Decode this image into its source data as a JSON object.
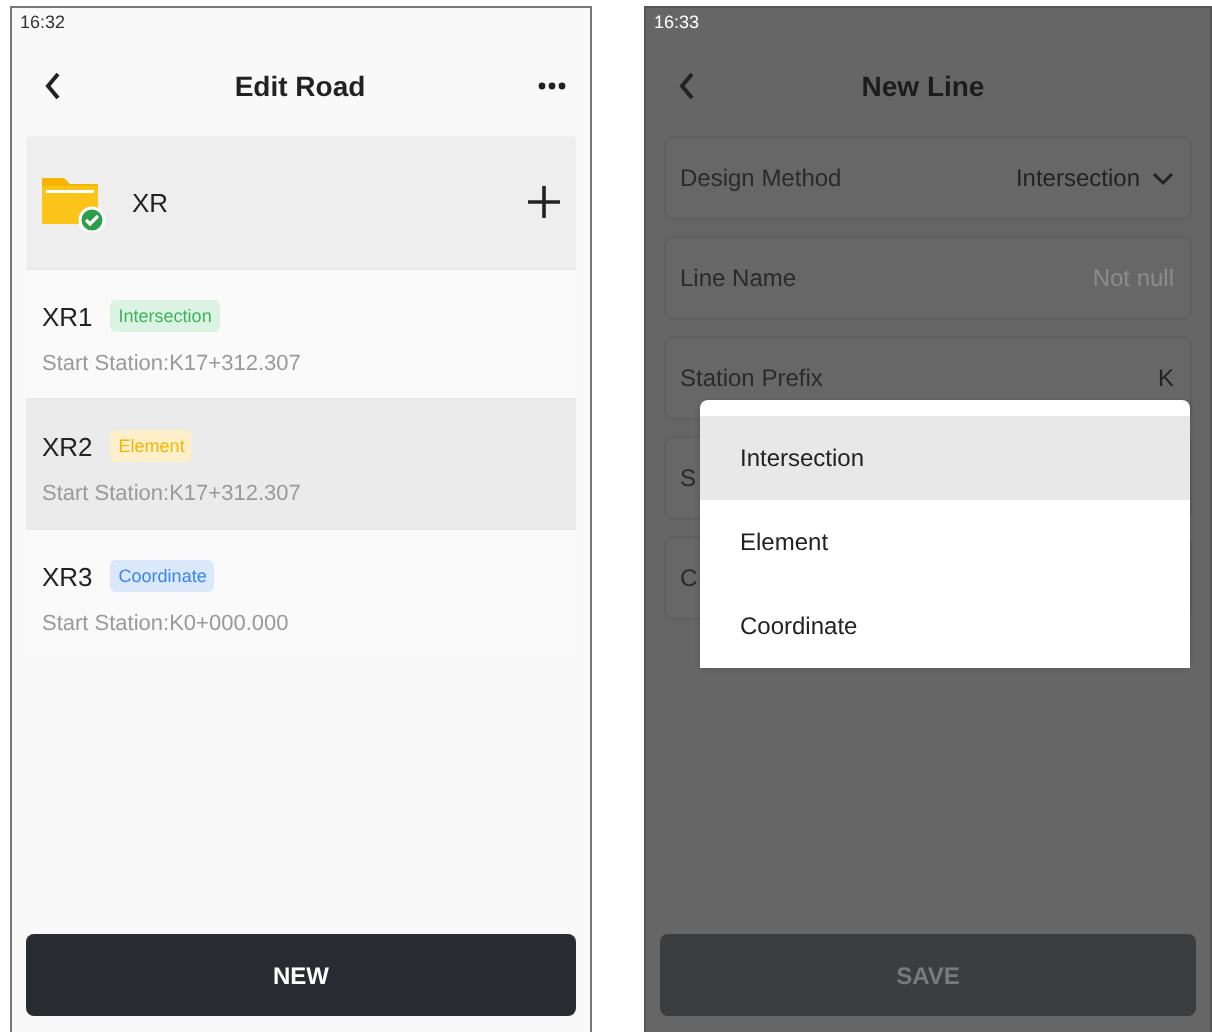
{
  "edit_road": {
    "status_time": "16:32",
    "title": "Edit Road",
    "folder": {
      "name": "XR"
    },
    "lines": [
      {
        "name": "XR1",
        "method": "Intersection",
        "kind": "intersection",
        "station": "Start Station:K17+312.307",
        "selected": false
      },
      {
        "name": "XR2",
        "method": "Element",
        "kind": "element",
        "station": "Start Station:K17+312.307",
        "selected": true
      },
      {
        "name": "XR3",
        "method": "Coordinate",
        "kind": "coordinate",
        "station": "Start Station:K0+000.000",
        "selected": false
      }
    ],
    "new_button": "NEW"
  },
  "new_line": {
    "status_time": "16:33",
    "title": "New Line",
    "fields": [
      {
        "kind": "dropdown",
        "label": "Design Method",
        "value": "Intersection"
      },
      {
        "kind": "input",
        "label": "Line Name",
        "placeholder": "Not null"
      },
      {
        "kind": "text",
        "label": "Station Prefix",
        "value": "K"
      },
      {
        "kind": "partial",
        "label": "S"
      },
      {
        "kind": "partial",
        "label": "C"
      }
    ],
    "menu": [
      {
        "label": "Intersection",
        "selected": true
      },
      {
        "label": "Element",
        "selected": false
      },
      {
        "label": "Coordinate",
        "selected": false
      }
    ],
    "save_button": {
      "label": "SAVE",
      "disabled": true
    }
  }
}
